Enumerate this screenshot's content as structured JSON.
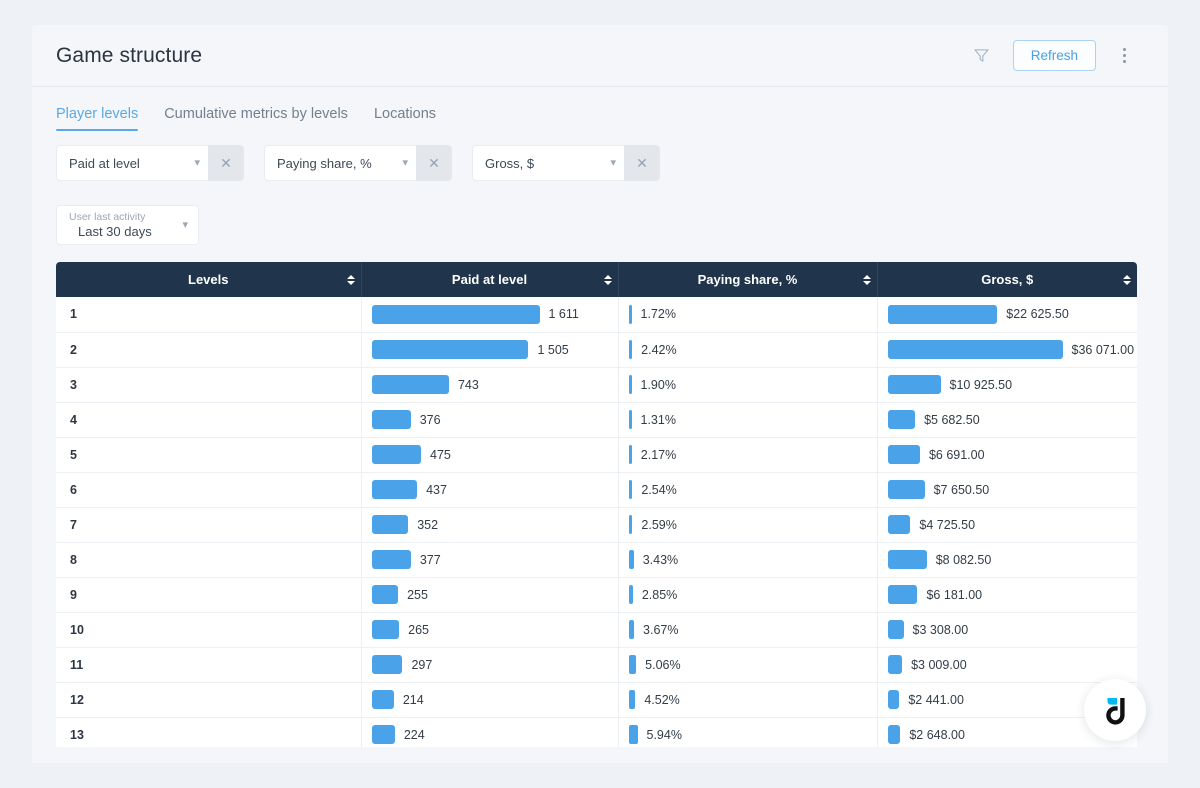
{
  "header": {
    "title": "Game structure",
    "filter_icon": "funnel-icon",
    "refresh_label": "Refresh",
    "menu_icon": "kebab-menu-icon"
  },
  "tabs": [
    {
      "label": "Player levels",
      "active": true
    },
    {
      "label": "Cumulative metrics by levels",
      "active": false
    },
    {
      "label": "Locations",
      "active": false
    }
  ],
  "filters": {
    "selects": [
      {
        "value": "Paid at level",
        "clear_icon": "close-icon",
        "chevron_icon": "chevron-down-icon"
      },
      {
        "value": "Paying share, %",
        "clear_icon": "close-icon",
        "chevron_icon": "chevron-down-icon"
      },
      {
        "value": "Gross, $",
        "clear_icon": "close-icon",
        "chevron_icon": "chevron-down-icon"
      }
    ],
    "activity": {
      "caption": "User last activity",
      "value": "Last 30 days",
      "chevron_icon": "chevron-down-icon"
    }
  },
  "table": {
    "columns": [
      {
        "label": "Levels",
        "sort_icon": "sort-arrows-icon"
      },
      {
        "label": "Paid at level",
        "sort_icon": "sort-arrows-icon"
      },
      {
        "label": "Paying share, %",
        "sort_icon": "sort-arrows-icon"
      },
      {
        "label": "Gross, $",
        "sort_icon": "sort-arrows-icon"
      }
    ],
    "rows": [
      {
        "level": "1",
        "paid": "1 611",
        "paid_n": 1611,
        "share": "1.72%",
        "share_n": 1.72,
        "gross": "$22 625.50",
        "gross_n": 22625.5
      },
      {
        "level": "2",
        "paid": "1 505",
        "paid_n": 1505,
        "share": "2.42%",
        "share_n": 2.42,
        "gross": "$36 071.00",
        "gross_n": 36071.0
      },
      {
        "level": "3",
        "paid": "743",
        "paid_n": 743,
        "share": "1.90%",
        "share_n": 1.9,
        "gross": "$10 925.50",
        "gross_n": 10925.5
      },
      {
        "level": "4",
        "paid": "376",
        "paid_n": 376,
        "share": "1.31%",
        "share_n": 1.31,
        "gross": "$5 682.50",
        "gross_n": 5682.5
      },
      {
        "level": "5",
        "paid": "475",
        "paid_n": 475,
        "share": "2.17%",
        "share_n": 2.17,
        "gross": "$6 691.00",
        "gross_n": 6691.0
      },
      {
        "level": "6",
        "paid": "437",
        "paid_n": 437,
        "share": "2.54%",
        "share_n": 2.54,
        "gross": "$7 650.50",
        "gross_n": 7650.5
      },
      {
        "level": "7",
        "paid": "352",
        "paid_n": 352,
        "share": "2.59%",
        "share_n": 2.59,
        "gross": "$4 725.50",
        "gross_n": 4725.5
      },
      {
        "level": "8",
        "paid": "377",
        "paid_n": 377,
        "share": "3.43%",
        "share_n": 3.43,
        "gross": "$8 082.50",
        "gross_n": 8082.5
      },
      {
        "level": "9",
        "paid": "255",
        "paid_n": 255,
        "share": "2.85%",
        "share_n": 2.85,
        "gross": "$6 181.00",
        "gross_n": 6181.0
      },
      {
        "level": "10",
        "paid": "265",
        "paid_n": 265,
        "share": "3.67%",
        "share_n": 3.67,
        "gross": "$3 308.00",
        "gross_n": 3308.0
      },
      {
        "level": "11",
        "paid": "297",
        "paid_n": 297,
        "share": "5.06%",
        "share_n": 5.06,
        "gross": "$3 009.00",
        "gross_n": 3009.0
      },
      {
        "level": "12",
        "paid": "214",
        "paid_n": 214,
        "share": "4.52%",
        "share_n": 4.52,
        "gross": "$2 441.00",
        "gross_n": 2441.0
      },
      {
        "level": "13",
        "paid": "224",
        "paid_n": 224,
        "share": "5.94%",
        "share_n": 5.94,
        "gross": "$2 648.00",
        "gross_n": 2648.0
      }
    ]
  },
  "fab": {
    "logo": "devtodev-d-logo"
  },
  "colors": {
    "accent": "#4aa3e8",
    "header_bg": "#20354b",
    "page_bg": "#eef1f5",
    "card_bg": "#f4f6f9",
    "logo_cyan": "#00b9f2"
  },
  "chart_data": {
    "type": "table",
    "title": "Game structure — Player levels",
    "columns": [
      "Levels",
      "Paid at level",
      "Paying share, %",
      "Gross, $"
    ],
    "categories": [
      "1",
      "2",
      "3",
      "4",
      "5",
      "6",
      "7",
      "8",
      "9",
      "10",
      "11",
      "12",
      "13"
    ],
    "series": [
      {
        "name": "Paid at level",
        "values": [
          1611,
          1505,
          743,
          376,
          475,
          437,
          352,
          377,
          255,
          265,
          297,
          214,
          224
        ]
      },
      {
        "name": "Paying share, %",
        "values": [
          1.72,
          2.42,
          1.9,
          1.31,
          2.17,
          2.54,
          2.59,
          3.43,
          2.85,
          3.67,
          5.06,
          4.52,
          5.94
        ]
      },
      {
        "name": "Gross, $",
        "values": [
          22625.5,
          36071.0,
          10925.5,
          5682.5,
          6691.0,
          7650.5,
          4725.5,
          8082.5,
          6181.0,
          3308.0,
          3009.0,
          2441.0,
          2648.0
        ]
      }
    ],
    "xlabel": "Levels",
    "ylabel": "",
    "grid": false,
    "legend": "none"
  }
}
